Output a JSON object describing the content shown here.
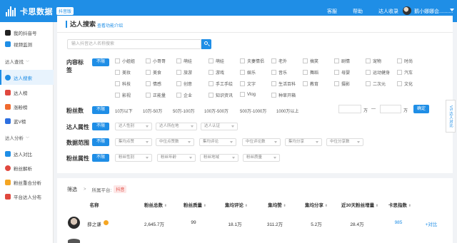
{
  "topbar": {
    "brand": "卡思数据",
    "badge": "抖音版",
    "nav": [
      "客服",
      "帮助",
      "达人收录"
    ],
    "username": "鹅小娜娜会.........."
  },
  "sidebar": {
    "items_top": [
      {
        "label": "我的抖音号",
        "icon": "douyin-icon"
      },
      {
        "label": "视频监测",
        "icon": "video-monitor-icon"
      }
    ],
    "group1": "达人查找",
    "group1_items": [
      {
        "label": "达人搜索",
        "icon": "search-icon",
        "active": true
      },
      {
        "label": "达人榜",
        "icon": "rank-icon"
      },
      {
        "label": "涨粉榜",
        "icon": "rise-icon"
      },
      {
        "label": "蓝V榜",
        "icon": "blue-v-icon"
      }
    ],
    "group2": "达人分析",
    "group2_items": [
      {
        "label": "达人对比",
        "icon": "compare-icon"
      },
      {
        "label": "粉丝解析",
        "icon": "fans-icon"
      },
      {
        "label": "粉丝重合分析",
        "icon": "overlap-icon"
      },
      {
        "label": "平台达人分布",
        "icon": "distribution-icon"
      }
    ]
  },
  "panel": {
    "title": "达人搜索",
    "help_link": "查看功能介绍",
    "search_placeholder": "输入抖音达人名称搜索"
  },
  "filters": {
    "content_label": "内容标签",
    "all": "不限",
    "tags_row1": [
      "小姐姐",
      "小哥哥",
      "萌娃",
      "萌娃",
      "夫妻情侣",
      "老外",
      "搞笑",
      "剧情",
      "宠物",
      "时尚"
    ],
    "tags_row2": [
      "美妆",
      "美食",
      "旅游",
      "游戏",
      "娱乐",
      "音乐",
      "舞蹈",
      "母婴",
      "运动健身",
      "汽车"
    ],
    "tags_row3": [
      "科技",
      "情感",
      "创意",
      "手工手绘",
      "文字",
      "生活百科",
      "教育",
      "摄影",
      "二次元",
      "文化"
    ],
    "tags_row4": [
      "影视",
      "正能量",
      "企业",
      "知识资讯",
      "Vlog",
      "种草开箱"
    ],
    "fans_label": "粉丝数",
    "fans_options": [
      "10万以下",
      "10万-50万",
      "50万-100万",
      "100万-500万",
      "500万-1000万",
      "1000万以上"
    ],
    "fans_unit": "万",
    "fans_sep": "—",
    "confirm": "确定",
    "attr_label": "达人属性",
    "attr_selects": [
      "达人性别",
      "达人所在地",
      "达人认证"
    ],
    "data_label": "数据范围",
    "data_selects": [
      "集均点赞",
      "中位点赞数",
      "集均评论",
      "中位评论数",
      "集均分享",
      "中位分享数"
    ],
    "fanattr_label": "粉丝属性",
    "fanattr_selects": [
      "粉丝性别",
      "粉丝年龄",
      "粉丝地域",
      "粉丝质量"
    ]
  },
  "side_tab": "VS 达人对比",
  "results": {
    "filter_label": "筛选",
    "arrow": ">",
    "platform_label": "所属平台:",
    "platform_tag": "抖音",
    "columns": [
      "名称",
      "粉丝总数",
      "粉丝质量",
      "集均评论",
      "集均赞",
      "集均分享",
      "近30天粉丝增量",
      "卡思指数"
    ],
    "sorter": "⬍",
    "row": {
      "name": "薛之谦",
      "fans": "2,645.7万",
      "quality": "99",
      "comments": "18.1万",
      "likes": "311.2万",
      "shares": "5.2万",
      "growth": "28.4万",
      "index": "985",
      "action": "+对比"
    }
  }
}
